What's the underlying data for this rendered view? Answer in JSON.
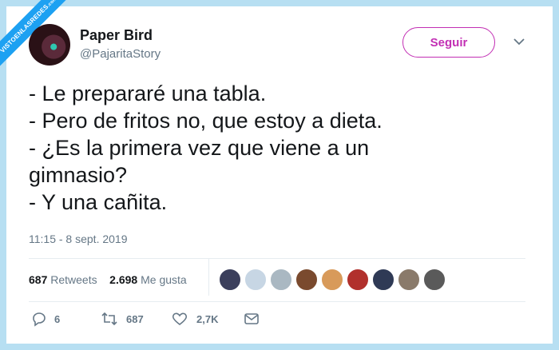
{
  "watermark": {
    "text": "VISTOENLASREDES",
    "suffix": ".com"
  },
  "author": {
    "name": "Paper Bird",
    "handle": "@PajaritaStory"
  },
  "follow_label": "Seguir",
  "tweet_lines": [
    "- Le prepararé una tabla.",
    "- Pero de fritos no, que estoy a dieta.",
    "- ¿Es la primera vez que viene a un",
    "gimnasio?",
    "- Y una cañita."
  ],
  "timestamp": "11:15 - 8 sept. 2019",
  "stats": {
    "retweets_count": "687",
    "retweets_label": "Retweets",
    "likes_count": "2.698",
    "likes_label": "Me gusta"
  },
  "liker_avatar_colors": [
    "#3b3f5c",
    "#c7d6e4",
    "#aab8c2",
    "#7a4a2e",
    "#d89a5a",
    "#b1302c",
    "#2f3a55",
    "#8a7a6a",
    "#5a5a5a"
  ],
  "actions": {
    "replies": "6",
    "retweets": "687",
    "likes": "2,7K"
  },
  "colors": {
    "follow_accent": "#c22fb4",
    "ribbon": "#1da1f2",
    "background": "#b7dff2"
  }
}
